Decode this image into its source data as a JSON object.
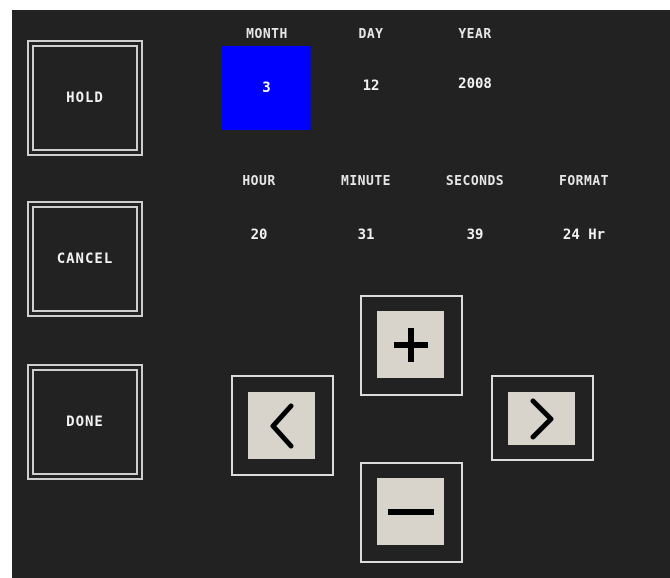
{
  "buttons": {
    "hold": "HOLD",
    "cancel": "CANCEL",
    "done": "DONE"
  },
  "date": {
    "month_label": "MONTH",
    "day_label": "DAY",
    "year_label": "YEAR",
    "month": "3",
    "day": "12",
    "year": "2008"
  },
  "time": {
    "hour_label": "HOUR",
    "minute_label": "MINUTE",
    "seconds_label": "SECONDS",
    "format_label": "FORMAT",
    "hour": "20",
    "minute": "31",
    "seconds": "39",
    "format": "24 Hr"
  },
  "icons": {
    "increment": "plus-icon",
    "decrement": "minus-icon",
    "left": "chevron-left-icon",
    "right": "chevron-right-icon"
  },
  "colors": {
    "background": "#222222",
    "selected": "#0000ff",
    "button_face": "#d8d4cc"
  }
}
